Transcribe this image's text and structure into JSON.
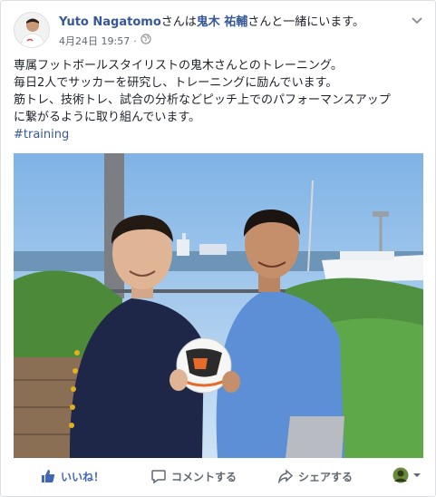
{
  "post": {
    "author": "Yuto Nagatomo",
    "with_prefix": "さんは",
    "tagged": "鬼木 祐輔",
    "with_suffix": "さんと一緒にいます。",
    "date": "4月24日 19:57",
    "dot": "·",
    "body_lines": [
      "専属フットボールスタイリストの鬼木さんとのトレーニング。",
      "毎日2人でサッカーを研究し、トレーニングに励んでいます。",
      "筋トレ、技術トレ、試合の分析などピッチ上でのパフォーマンスアップ",
      "に繋がるように取り組んでいます。"
    ],
    "hashtag": "#training"
  },
  "actions": {
    "like": "いいね！",
    "comment": "コメントする",
    "share": "シェアする"
  },
  "icons": {
    "globe": "globe-icon",
    "chevron": "chevron-down-icon",
    "like": "thumbs-up-icon",
    "comment": "comment-icon",
    "share": "share-icon"
  },
  "colors": {
    "link": "#365899",
    "like_blue": "#4267b2",
    "muted": "#616770"
  }
}
